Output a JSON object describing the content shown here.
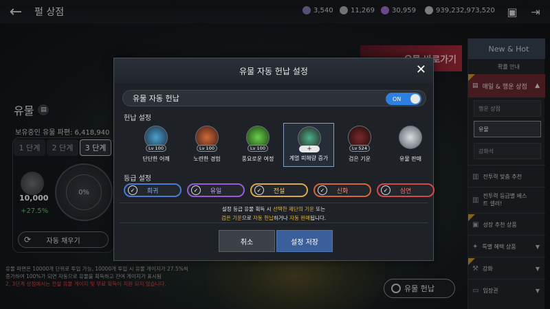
{
  "header": {
    "back": "←",
    "title": "펄 상점"
  },
  "currencies": [
    {
      "value": "3,540",
      "color": "#8a7ab0",
      "icon": "pearl-icon"
    },
    {
      "value": "11,269",
      "color": "#b0b0b0",
      "icon": "silver-icon"
    },
    {
      "value": "30,959",
      "color": "#a56fd0",
      "icon": "purple-gem-icon"
    },
    {
      "value": "939,232,973,520",
      "color": "#c0c0c0",
      "icon": "coin-icon"
    }
  ],
  "banner": {
    "text": "유물 바로가기"
  },
  "left": {
    "title": "유물",
    "owned": "보유중인 유물 파편: 6,418,940",
    "stages": [
      "1 단계",
      "2 단계",
      "3 단계"
    ],
    "gauge": "0%",
    "count": "10,000",
    "percent": "+27.5%",
    "autofill": "자동 채우기",
    "notes": [
      "유물 파편은 10000개 단위로 투입 가능, 10000개 투입 시 유물 게이지가 27.5%씩",
      "증가하여 100%가 되면 자동으로 유물을 획득하고 잔여 게이지가 표시됨",
      "2, 3단계 상점에서는 전설 유물 게이지 및 무료 획득이 지원 되지 않습니다."
    ]
  },
  "relic_button": "유물 헌납",
  "sidebar": {
    "top": "New & Hot",
    "guide": "확률 안내",
    "daily": "매일 & 행운 상점",
    "subs": [
      "행운 상점",
      "유물",
      "강화석"
    ],
    "menus": [
      "전투력 맞춤 추천",
      "전투력 등급별 베스트 셀러!",
      "성장 추천 상품",
      "특별 혜택 상품",
      "강화",
      "입장권"
    ]
  },
  "modal": {
    "title": "유물 자동 헌납 설정",
    "close": "✕",
    "toggle_label": "유물 자동 헌납",
    "toggle_state": "ON",
    "section1": "헌납 설정",
    "section2": "등급 설정",
    "items": [
      {
        "name": "단단한 어깨",
        "lv": "Lv 100",
        "color": "#2e6aa0"
      },
      {
        "name": "노련한 경험",
        "lv": "Lv 100",
        "color": "#a0442e"
      },
      {
        "name": "풍요로운 여정",
        "lv": "Lv 100",
        "color": "#3e8a3a"
      },
      {
        "name": "계열 피해량 증가",
        "lv": "+",
        "color": "#2f6a5a"
      },
      {
        "name": "검은 기운",
        "lv": "Lv 524",
        "color": "#5a2a2a"
      },
      {
        "name": "유물 판매",
        "lv": "",
        "color": "#8a8e94"
      }
    ],
    "grades": [
      {
        "label": "희귀",
        "color": "#4a7ad8"
      },
      {
        "label": "유일",
        "color": "#9a5ad8"
      },
      {
        "label": "전설",
        "color": "#d8a84a"
      },
      {
        "label": "신화",
        "color": "#d8653a"
      },
      {
        "label": "심연",
        "color": "#d84a4a"
      }
    ],
    "info_line1_a": "설정 등급 유물 획득 시 ",
    "info_line1_b": "선택한 제단의 기운",
    "info_line1_c": " 또는",
    "info_line2_a": "검은 기운",
    "info_line2_b": "으로 ",
    "info_line2_c": "자동 헌납",
    "info_line2_d": "하거나 ",
    "info_line2_e": "자동 판매",
    "info_line2_f": "됩니다.",
    "cancel": "취소",
    "save": "설정 저장"
  }
}
